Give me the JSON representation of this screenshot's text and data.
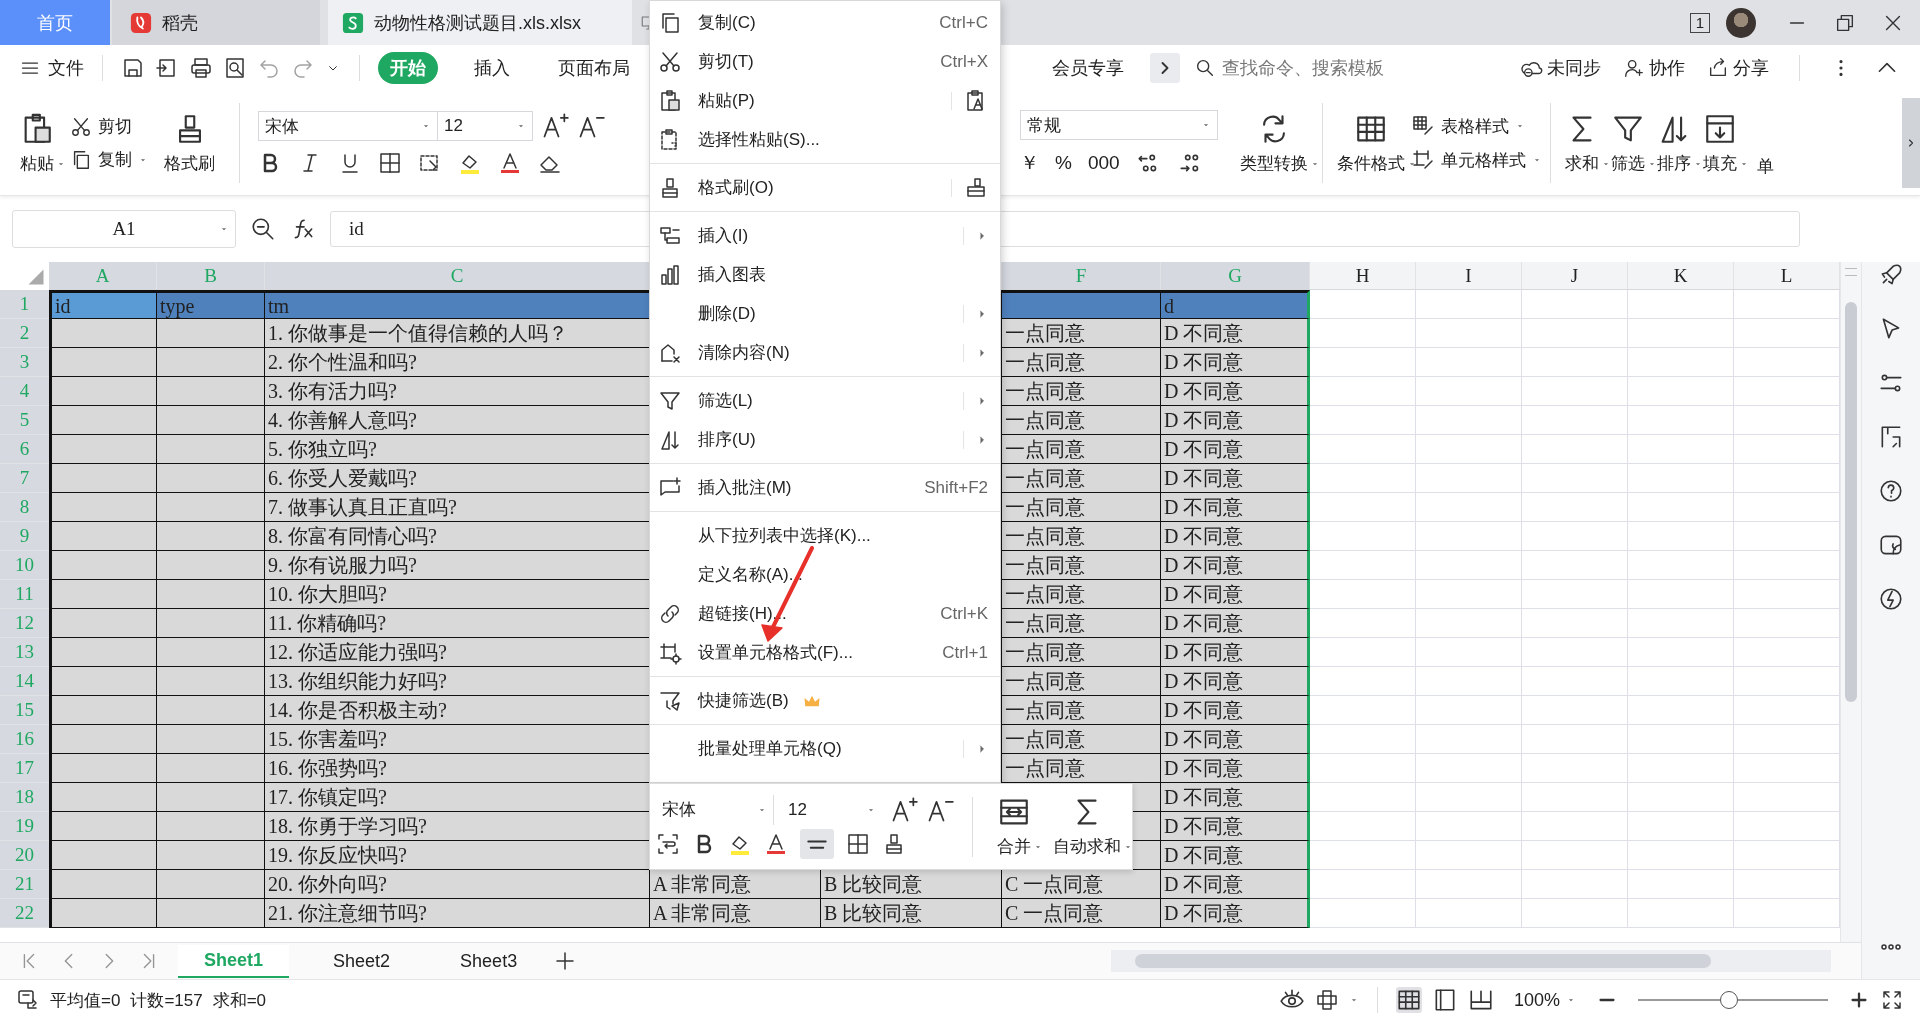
{
  "tabs": [
    {
      "label": "首页",
      "kind": "home",
      "selected": false
    },
    {
      "label": "稻壳",
      "kind": "docer",
      "selected": false
    },
    {
      "label": "动物性格测试题目.xls.xlsx",
      "kind": "sheet",
      "selected": true
    }
  ],
  "window_controls": {
    "window_count": "1"
  },
  "menu_bar": {
    "file": "文件",
    "tabs": [
      {
        "label": "开始",
        "selected": true
      },
      {
        "label": "插入",
        "selected": false
      },
      {
        "label": "页面布局",
        "selected": false
      }
    ],
    "member_tab": "会员专享",
    "search": {
      "placeholder": "查找命令、搜索模板"
    },
    "actions": [
      "未同步",
      "协作",
      "分享"
    ]
  },
  "ribbon": {
    "paste": "粘贴",
    "cut": "剪切",
    "copy": "复制",
    "format_painter": "格式刷",
    "font": "宋体",
    "font_size": "12",
    "number_format": "常规",
    "number_buttons": [
      "￥",
      "%",
      "000"
    ],
    "large_buttons": [
      "类型转换",
      "条件格式"
    ],
    "style_buttons": [
      "表格样式",
      "单元格样式"
    ],
    "tool_buttons": [
      "求和",
      "筛选",
      "排序",
      "填充",
      "单"
    ]
  },
  "formula_bar": {
    "name_box": "A1",
    "formula": "id"
  },
  "grid": {
    "columns": [
      {
        "label": "A",
        "selected": true
      },
      {
        "label": "B",
        "selected": true
      },
      {
        "label": "C",
        "selected": true
      },
      null,
      null,
      {
        "label": "F",
        "selected": true
      },
      {
        "label": "G",
        "selected": true
      },
      {
        "label": "H",
        "selected": false
      },
      {
        "label": "I",
        "selected": false
      },
      {
        "label": "J",
        "selected": false
      },
      {
        "label": "K",
        "selected": false
      },
      {
        "label": "L",
        "selected": false
      }
    ],
    "rows": [
      {
        "number": "1",
        "kind": "header",
        "cells": [
          {
            "text": "id",
            "active": true
          },
          {
            "text": "type"
          },
          {
            "text": "tm"
          },
          null,
          null,
          null,
          {
            "text": "d"
          }
        ]
      },
      {
        "number": "2",
        "kind": "data",
        "cells": [
          null,
          null,
          {
            "text": "1. 你做事是一个值得信赖的人吗？"
          },
          null,
          null,
          {
            "text": "一点同意"
          },
          {
            "text": "D 不同意"
          }
        ]
      },
      {
        "number": "3",
        "kind": "data",
        "cells": [
          null,
          null,
          {
            "text": "2. 你个性温和吗?"
          },
          null,
          null,
          {
            "text": "一点同意"
          },
          {
            "text": "D 不同意"
          }
        ]
      },
      {
        "number": "4",
        "kind": "data",
        "cells": [
          null,
          null,
          {
            "text": "3. 你有活力吗?"
          },
          null,
          null,
          {
            "text": "一点同意"
          },
          {
            "text": "D 不同意"
          }
        ]
      },
      {
        "number": "5",
        "kind": "data",
        "cells": [
          null,
          null,
          {
            "text": "4. 你善解人意吗?"
          },
          null,
          null,
          {
            "text": "一点同意"
          },
          {
            "text": "D 不同意"
          }
        ]
      },
      {
        "number": "6",
        "kind": "data",
        "cells": [
          null,
          null,
          {
            "text": "5. 你独立吗?"
          },
          null,
          null,
          {
            "text": "一点同意"
          },
          {
            "text": "D 不同意"
          }
        ]
      },
      {
        "number": "7",
        "kind": "data",
        "cells": [
          null,
          null,
          {
            "text": "6. 你受人爱戴吗?"
          },
          null,
          null,
          {
            "text": "一点同意"
          },
          {
            "text": "D 不同意"
          }
        ]
      },
      {
        "number": "8",
        "kind": "data",
        "cells": [
          null,
          null,
          {
            "text": "7. 做事认真且正直吗?"
          },
          null,
          null,
          {
            "text": "一点同意"
          },
          {
            "text": "D 不同意"
          }
        ]
      },
      {
        "number": "9",
        "kind": "data",
        "cells": [
          null,
          null,
          {
            "text": "8. 你富有同情心吗?"
          },
          null,
          null,
          {
            "text": "一点同意"
          },
          {
            "text": "D 不同意"
          }
        ]
      },
      {
        "number": "10",
        "kind": "data",
        "cells": [
          null,
          null,
          {
            "text": "9. 你有说服力吗?"
          },
          null,
          null,
          {
            "text": "一点同意"
          },
          {
            "text": "D 不同意"
          }
        ]
      },
      {
        "number": "11",
        "kind": "data",
        "cells": [
          null,
          null,
          {
            "text": "10. 你大胆吗?"
          },
          null,
          null,
          {
            "text": "一点同意"
          },
          {
            "text": "D 不同意"
          }
        ]
      },
      {
        "number": "12",
        "kind": "data",
        "cells": [
          null,
          null,
          {
            "text": "11. 你精确吗?"
          },
          null,
          null,
          {
            "text": "一点同意"
          },
          {
            "text": "D 不同意"
          }
        ]
      },
      {
        "number": "13",
        "kind": "data",
        "cells": [
          null,
          null,
          {
            "text": "12. 你适应能力强吗?"
          },
          null,
          null,
          {
            "text": "一点同意"
          },
          {
            "text": "D 不同意"
          }
        ]
      },
      {
        "number": "14",
        "kind": "data",
        "cells": [
          null,
          null,
          {
            "text": "13. 你组织能力好吗?"
          },
          null,
          null,
          {
            "text": "一点同意"
          },
          {
            "text": "D 不同意"
          }
        ]
      },
      {
        "number": "15",
        "kind": "data",
        "cells": [
          null,
          null,
          {
            "text": "14. 你是否积极主动?"
          },
          null,
          null,
          {
            "text": "一点同意"
          },
          {
            "text": "D 不同意"
          }
        ]
      },
      {
        "number": "16",
        "kind": "data",
        "cells": [
          null,
          null,
          {
            "text": "15. 你害羞吗?"
          },
          null,
          null,
          {
            "text": "一点同意"
          },
          {
            "text": "D 不同意"
          }
        ]
      },
      {
        "number": "17",
        "kind": "data",
        "cells": [
          null,
          null,
          {
            "text": "16. 你强势吗?"
          },
          null,
          null,
          {
            "text": "一点同意"
          },
          {
            "text": "D 不同意"
          }
        ]
      },
      {
        "number": "18",
        "kind": "data",
        "cells": [
          null,
          null,
          {
            "text": "17. 你镇定吗?"
          },
          null,
          null,
          null,
          {
            "text": "D 不同意"
          }
        ]
      },
      {
        "number": "19",
        "kind": "data",
        "cells": [
          null,
          null,
          {
            "text": "18. 你勇于学习吗?"
          },
          null,
          null,
          null,
          {
            "text": "D 不同意"
          }
        ]
      },
      {
        "number": "20",
        "kind": "data",
        "cells": [
          null,
          null,
          {
            "text": "19. 你反应快吗?"
          },
          null,
          null,
          null,
          {
            "text": "D 不同意"
          }
        ]
      },
      {
        "number": "21",
        "kind": "data",
        "cells": [
          null,
          null,
          {
            "text": "20. 你外向吗?"
          },
          {
            "text": "A 非常同意"
          },
          {
            "text": "B 比较同意"
          },
          {
            "text": "C 一点同意"
          },
          {
            "text": "D 不同意"
          }
        ]
      },
      {
        "number": "22",
        "kind": "data",
        "cells": [
          null,
          null,
          {
            "text": "21. 你注意细节吗?"
          },
          {
            "text": "A 非常同意"
          },
          {
            "text": "B 比较同意"
          },
          {
            "text": "C 一点同意"
          },
          {
            "text": "D 不同意"
          }
        ]
      }
    ]
  },
  "context_menu": {
    "groups": [
      [
        {
          "label": "复制(C)",
          "shortcut": "Ctrl+C",
          "submenu": false
        },
        {
          "label": "剪切(T)",
          "shortcut": "Ctrl+X",
          "submenu": false
        },
        {
          "label": "粘贴(P)",
          "submenu": false
        },
        {
          "label": "选择性粘贴(S)...",
          "submenu": false
        }
      ],
      [
        {
          "label": "格式刷(O)",
          "submenu": false
        }
      ],
      [
        {
          "label": "插入(I)",
          "submenu": true
        },
        {
          "label": "插入图表",
          "submenu": false
        },
        {
          "label": "删除(D)",
          "submenu": true
        },
        {
          "label": "清除内容(N)",
          "submenu": true
        }
      ],
      [
        {
          "label": "筛选(L)",
          "submenu": true
        },
        {
          "label": "排序(U)",
          "submenu": true
        }
      ],
      [
        {
          "label": "插入批注(M)",
          "shortcut": "Shift+F2",
          "submenu": false
        }
      ],
      [
        {
          "label": "从下拉列表中选择(K)...",
          "submenu": false
        },
        {
          "label": "定义名称(A)...",
          "submenu": false
        },
        {
          "label": "超链接(H)...",
          "shortcut": "Ctrl+K",
          "submenu": false
        },
        {
          "label": "设置单元格格式(F)...",
          "shortcut": "Ctrl+1",
          "submenu": false
        }
      ],
      [
        {
          "label": "快捷筛选(B)",
          "submenu": false
        }
      ],
      [
        {
          "label": "批量处理单元格(Q)",
          "submenu": true
        }
      ]
    ]
  },
  "mini_toolbar": {
    "font": "宋体",
    "font_size": "12",
    "buttons": [
      "合并",
      "自动求和"
    ]
  },
  "sheets": [
    {
      "label": "Sheet1",
      "selected": true
    },
    {
      "label": "Sheet2",
      "selected": false
    },
    {
      "label": "Sheet3",
      "selected": false
    }
  ],
  "status_bar": {
    "stats": [
      "平均值=0",
      "计数=157",
      "求和=0"
    ],
    "zoom": "100%",
    "zoom_slider": {
      "level": 0.48
    }
  }
}
